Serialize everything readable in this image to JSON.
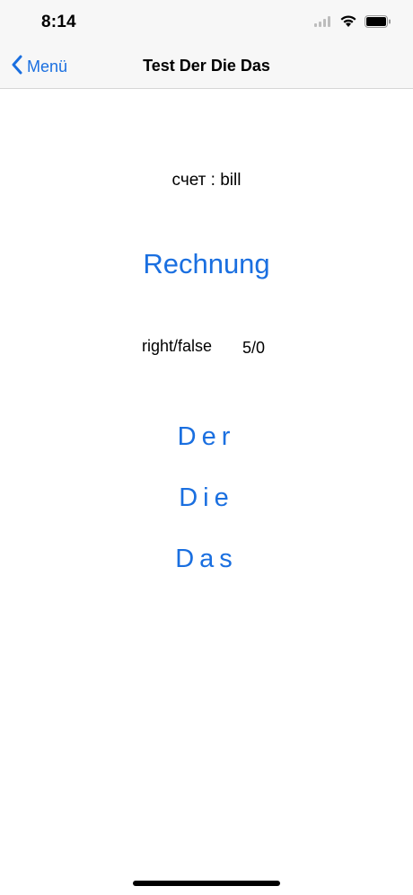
{
  "status_bar": {
    "time": "8:14",
    "icons": [
      "signal-icon",
      "wifi-icon",
      "battery-icon"
    ]
  },
  "nav_bar": {
    "back_label": "Menü",
    "title": "Test Der Die Das"
  },
  "quiz": {
    "translation": "счет : bill",
    "word": "Rechnung",
    "score_label": "right/false",
    "score_value": "5/0",
    "articles": {
      "der": "Der",
      "die": "Die",
      "das": "Das"
    }
  },
  "colors": {
    "accent": "#1a6fe0",
    "bar_background": "#f7f7f7"
  }
}
